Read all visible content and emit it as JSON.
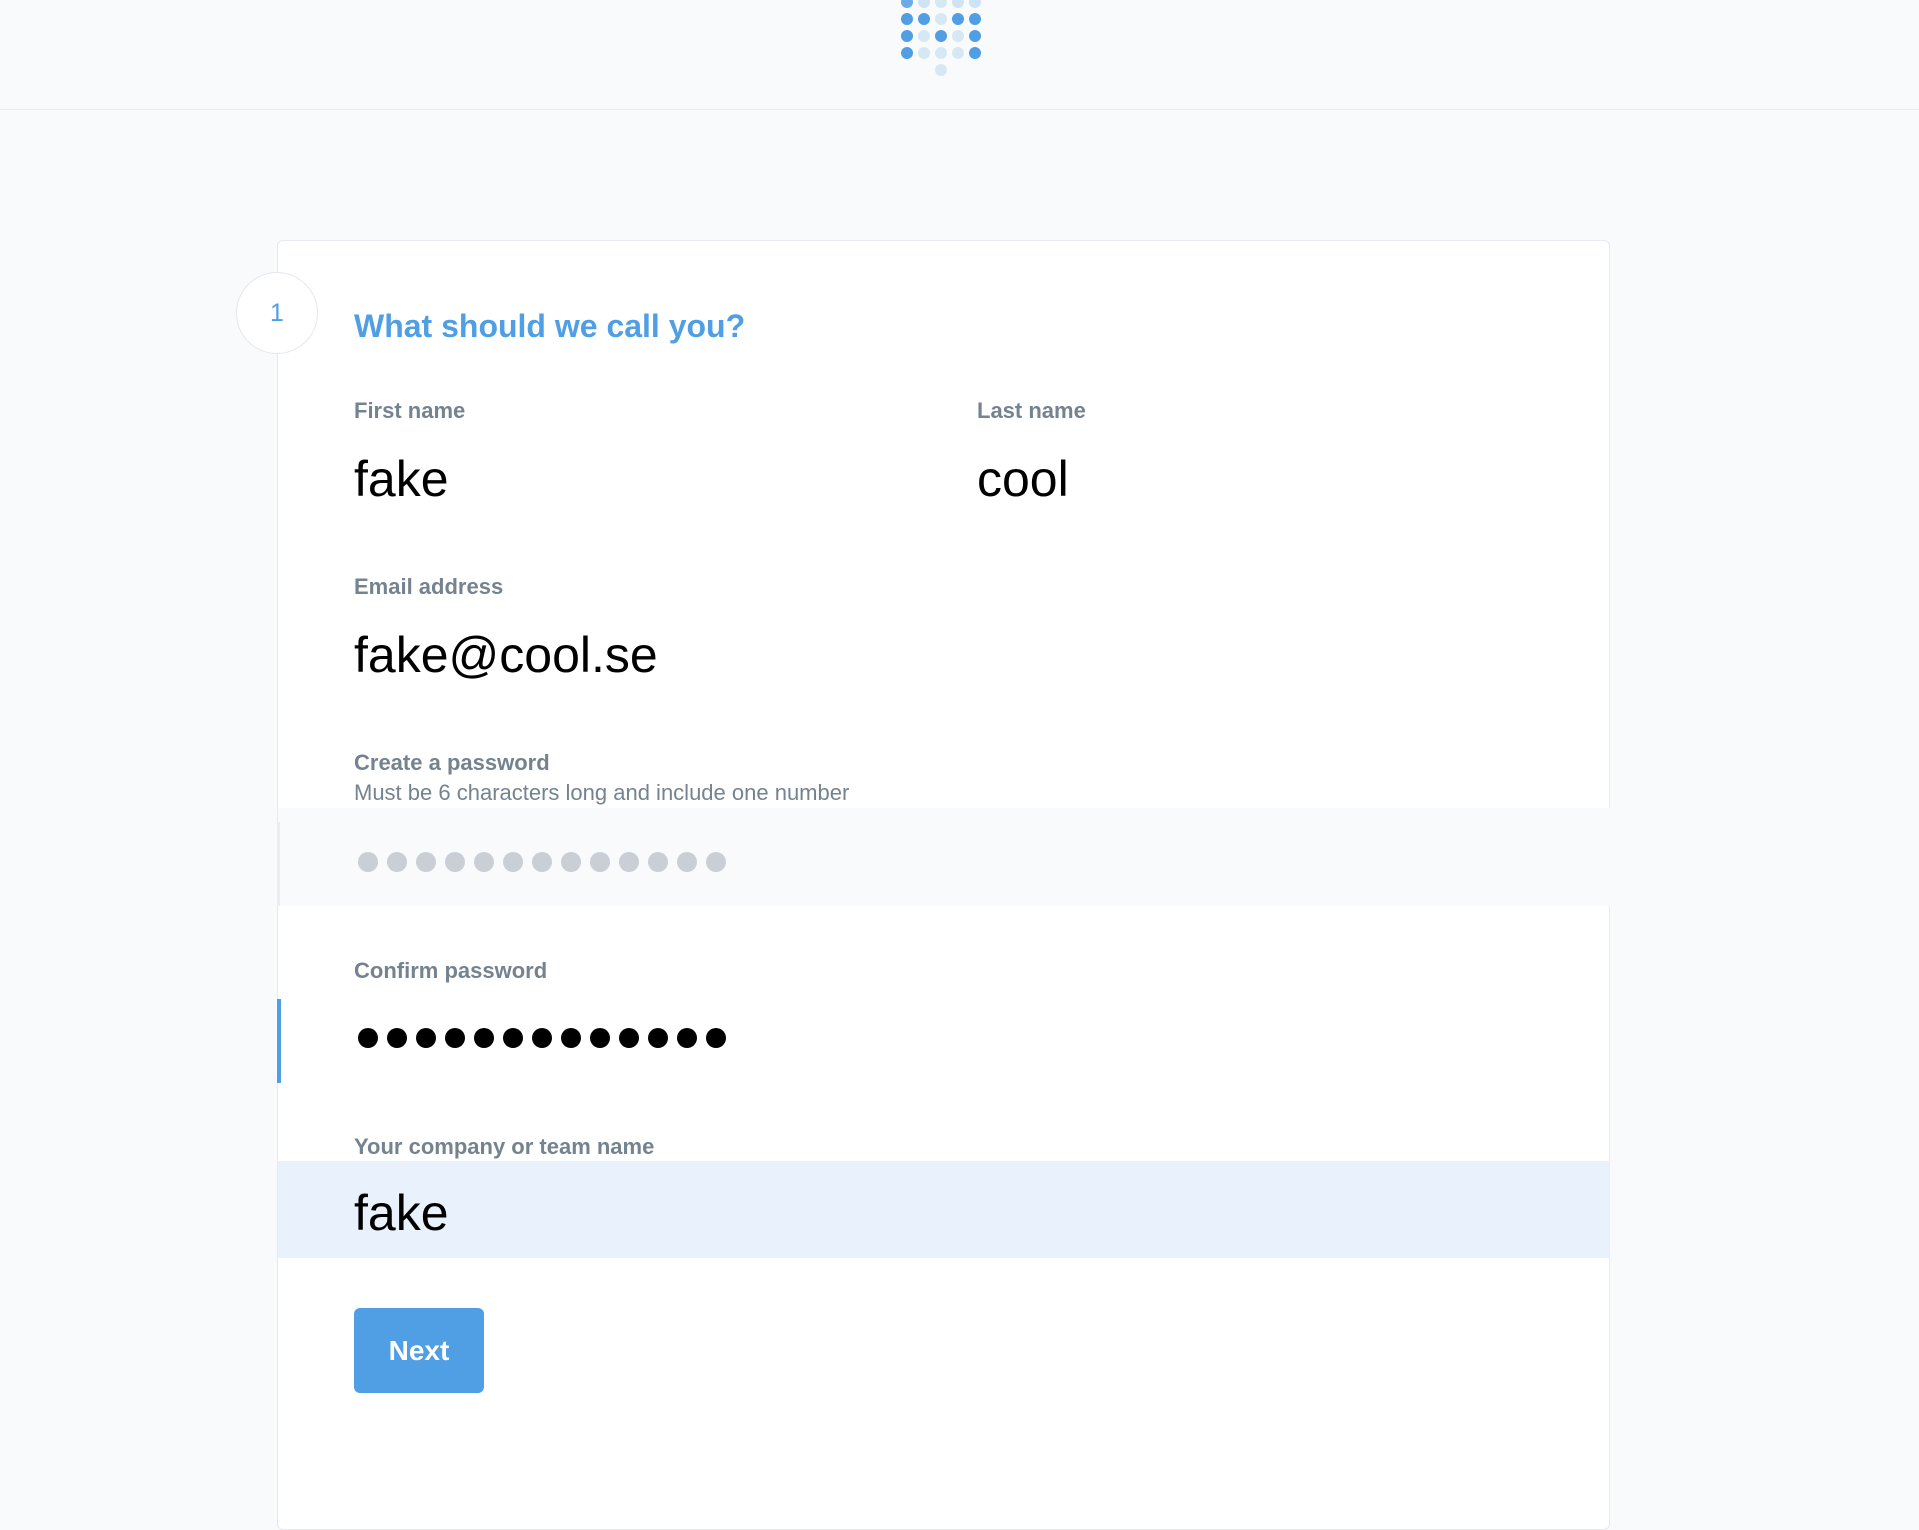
{
  "step": {
    "number": "1",
    "title": "What should we call you?"
  },
  "form": {
    "first_name": {
      "label": "First name",
      "value": "fake"
    },
    "last_name": {
      "label": "Last name",
      "value": "cool"
    },
    "email": {
      "label": "Email address",
      "value": "fake@cool.se"
    },
    "password": {
      "label": "Create a password",
      "hint": "Must be 6 characters long and include one number",
      "masked_length": 13
    },
    "confirm_password": {
      "label": "Confirm password",
      "masked_length": 13
    },
    "company": {
      "label": "Your company or team name",
      "value": "fake"
    }
  },
  "actions": {
    "next_label": "Next"
  },
  "colors": {
    "accent": "#509ee3",
    "label": "#74838f",
    "company_highlight": "#e9f1fc"
  },
  "icons": {
    "logo": "metabase-dot-logo"
  }
}
